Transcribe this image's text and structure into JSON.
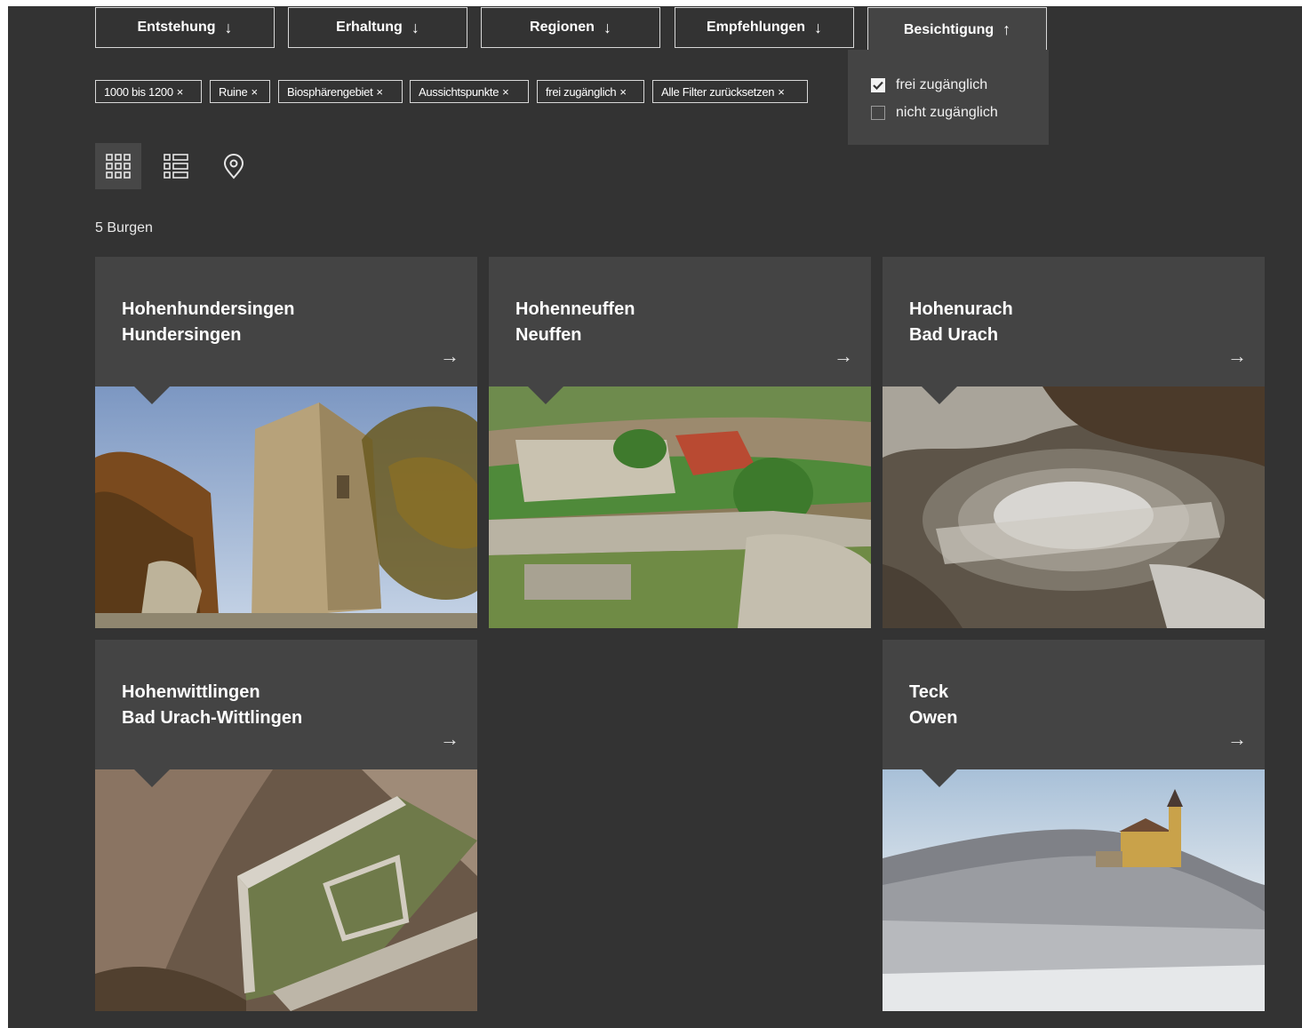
{
  "filters": [
    {
      "label": "Entstehung",
      "arrow": "↓"
    },
    {
      "label": "Erhaltung",
      "arrow": "↓"
    },
    {
      "label": "Regionen",
      "arrow": "↓"
    },
    {
      "label": "Empfehlungen",
      "arrow": "↓"
    },
    {
      "label": "Besichtigung",
      "arrow": "↑"
    }
  ],
  "dropdown": {
    "options": [
      {
        "label": "frei zugänglich",
        "checked": true
      },
      {
        "label": "nicht zugänglich",
        "checked": false
      }
    ]
  },
  "chips": [
    {
      "label": "1000 bis 1200"
    },
    {
      "label": "Ruine"
    },
    {
      "label": "Biosphärengebiet"
    },
    {
      "label": "Aussichtspunkte"
    },
    {
      "label": "frei zugänglich"
    },
    {
      "label": "Alle Filter zurücksetzen"
    }
  ],
  "chip_close": "×",
  "result_count": "5 Burgen",
  "arrow_glyph": "→",
  "cards": [
    {
      "name": "Hohenhundersingen",
      "place": "Hundersingen"
    },
    {
      "name": "Hohenneuffen",
      "place": "Neuffen"
    },
    {
      "name": "Hohenurach",
      "place": "Bad Urach"
    },
    {
      "name": "Hohenwittlingen",
      "place": "Bad Urach-Wittlingen"
    },
    {
      "name": "Teck",
      "place": "Owen"
    }
  ],
  "colors": {
    "background": "#333333",
    "card": "#444444",
    "border": "#d8d8d8"
  }
}
